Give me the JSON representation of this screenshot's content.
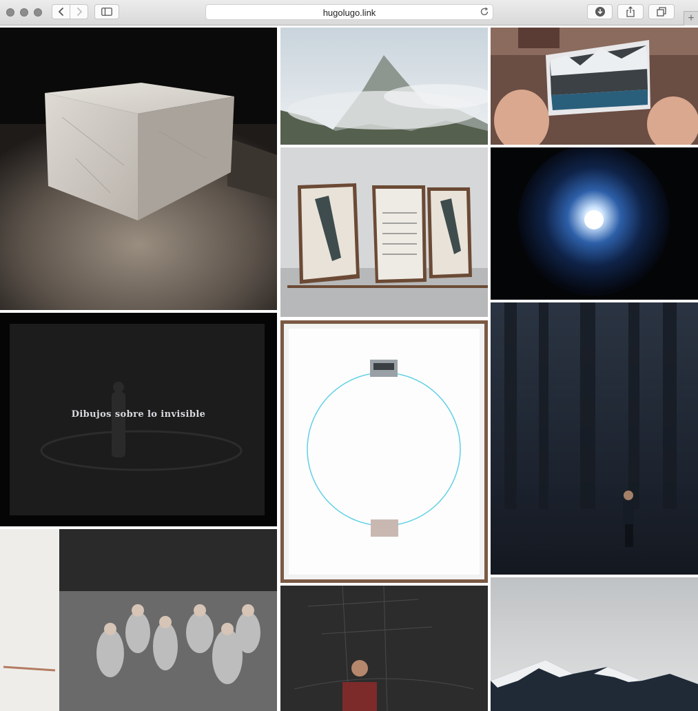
{
  "browser": {
    "url": "hugolugo.link",
    "new_tab_label": "+"
  },
  "gallery": {
    "tiles": [
      {
        "id": "marble-cube",
        "icon": "artwork-thumbnail"
      },
      {
        "id": "misty-mountain",
        "icon": "artwork-thumbnail"
      },
      {
        "id": "hands-postcard",
        "icon": "artwork-thumbnail"
      },
      {
        "id": "framed-flags-music",
        "icon": "artwork-thumbnail"
      },
      {
        "id": "galaxy-light",
        "icon": "artwork-thumbnail"
      },
      {
        "id": "dibujos-invisible",
        "caption": "Dibujos sobre lo invisible"
      },
      {
        "id": "circle-drawing",
        "icon": "artwork-thumbnail"
      },
      {
        "id": "man-in-dark-forest",
        "icon": "artwork-thumbnail"
      },
      {
        "id": "soldiers-painting",
        "icon": "artwork-thumbnail"
      },
      {
        "id": "man-ship-drawing",
        "icon": "artwork-thumbnail"
      },
      {
        "id": "snowy-mountains",
        "icon": "artwork-thumbnail"
      }
    ]
  },
  "colors": {
    "chrome_top": "#ececec",
    "chrome_bottom": "#d9d9d9",
    "cyan_circle": "#5fd0e6"
  }
}
